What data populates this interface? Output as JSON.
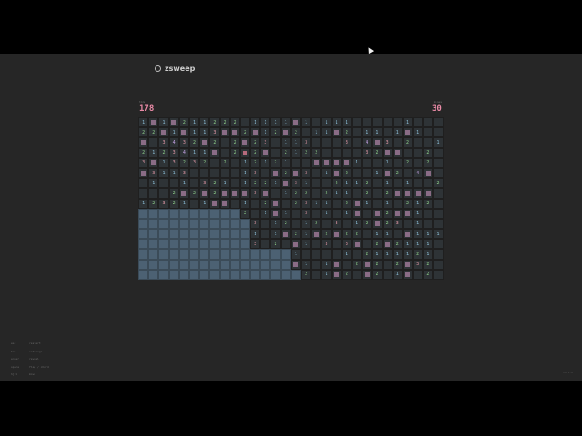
{
  "app": {
    "title": "zsweep"
  },
  "stats": {
    "time_label": "time",
    "time_value": "178",
    "mines_label": "mines",
    "mines_value": "30"
  },
  "board": {
    "rows": [
      "1f1f211222.1111f1.111.....1...",
      "22f1f113ff2f12f2.11f2.11.1f1..",
      "f.3432f2.2f23.113...3.4f3.2..1",
      "2123411f.2F2f.2122....32ff..2.",
      "3f13232.2.12121..ffff1..1.2.2.",
      "f3113.....13.f2f3.1f2..1f2.4f.",
      ".1..1.321.1221f31..2112.1.1..2",
      "...2f2f2fff3f.122.211.2.2ffff.",
      "12321.1ff.1.2f.2311.2f1.1.212.",
      "hhhhhhhhhh2.1f1.3.1.1f.f2ff1..",
      "hhhhhhhhhhh3.12.12.3.12f23.1..",
      "hhhhhhhhhhh1.1f21f2f22.11.f111",
      "hhhhhhhhhhh3.2.f1.3.3f.2f2111.",
      "hhhhhhhhhhhhhhh1....1.2111121.",
      "hhhhhhhhhhhhhhhf1.1f.2f2.2f32.",
      "hhhhhhhhhhhhhhhh2.1f2.f2.1f.2."
    ]
  },
  "help": [
    {
      "key": "esc",
      "desc": "restart"
    },
    {
      "key": "tab",
      "desc": "settings"
    },
    {
      "key": "enter",
      "desc": "reveal"
    },
    {
      "key": "space",
      "desc": "flag / chord"
    },
    {
      "key": "hjkl",
      "desc": "move"
    }
  ],
  "footer": {
    "version": "v0.1.0"
  }
}
